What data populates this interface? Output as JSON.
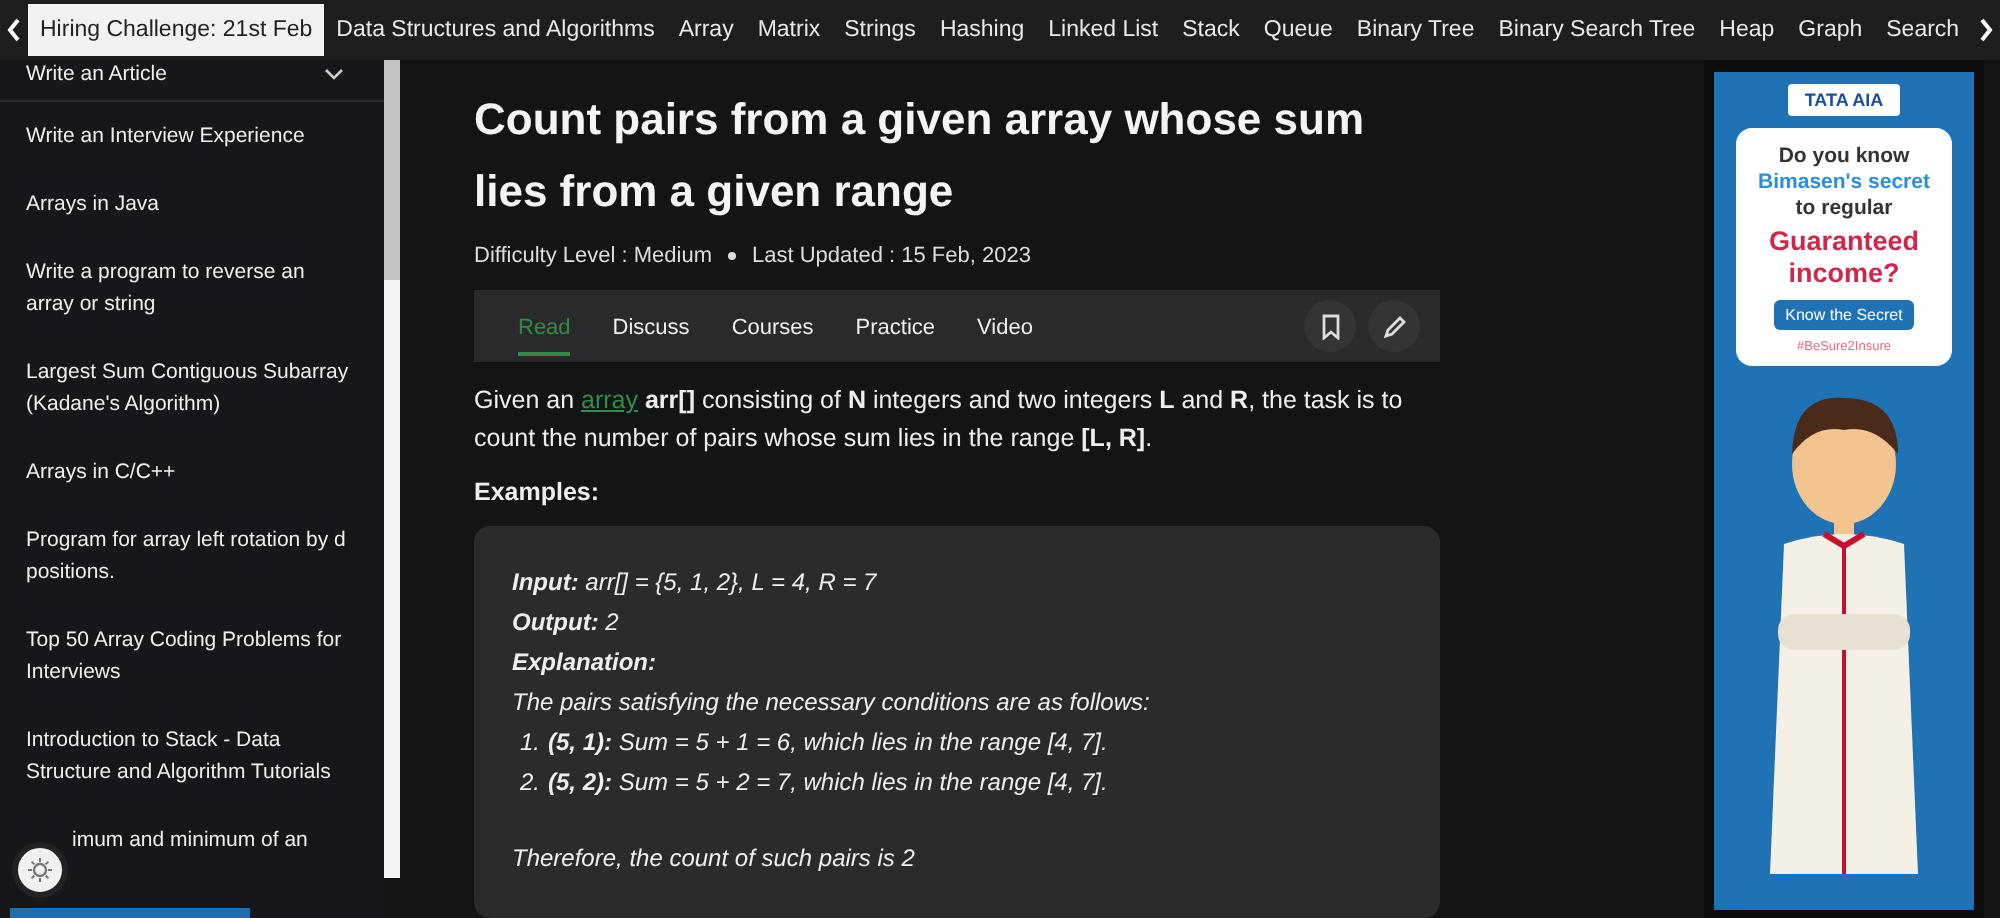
{
  "nav": {
    "items": [
      {
        "label": "Hiring Challenge: 21st Feb",
        "selected": true
      },
      {
        "label": "Data Structures and Algorithms",
        "selected": false
      },
      {
        "label": "Array",
        "selected": false
      },
      {
        "label": "Matrix",
        "selected": false
      },
      {
        "label": "Strings",
        "selected": false
      },
      {
        "label": "Hashing",
        "selected": false
      },
      {
        "label": "Linked List",
        "selected": false
      },
      {
        "label": "Stack",
        "selected": false
      },
      {
        "label": "Queue",
        "selected": false
      },
      {
        "label": "Binary Tree",
        "selected": false
      },
      {
        "label": "Binary Search Tree",
        "selected": false
      },
      {
        "label": "Heap",
        "selected": false
      },
      {
        "label": "Graph",
        "selected": false
      },
      {
        "label": "Search",
        "selected": false
      }
    ]
  },
  "sidebar": {
    "header": "Write an Article",
    "items": [
      "Write an Interview Experience",
      "Arrays in Java",
      "Write a program to reverse an array or string",
      "Largest Sum Contiguous Subarray (Kadane's Algorithm)",
      "Arrays in C/C++",
      "Program for array left rotation by d positions.",
      "Top 50 Array Coding Problems for Interviews",
      "Introduction to Stack - Data Structure and Algorithm Tutorials",
      "imum and minimum of an"
    ]
  },
  "article": {
    "title": "Count pairs from a given array whose sum lies from a given range",
    "difficulty": "Difficulty Level : Medium",
    "updated": "Last Updated : 15 Feb, 2023",
    "tabs": [
      {
        "label": "Read",
        "selected": true
      },
      {
        "label": "Discuss",
        "selected": false
      },
      {
        "label": "Courses",
        "selected": false
      },
      {
        "label": "Practice",
        "selected": false
      },
      {
        "label": "Video",
        "selected": false
      }
    ],
    "intro": {
      "before": "Given an",
      "link": "array",
      "after": "**arr[]** consisting of **N** integers and two integers **L** and **R**, the task is to count the number of pairs whose sum lies in the range **[L, R]**."
    },
    "examples_heading": "Examples:",
    "example": {
      "input": "**Input:** arr[] = {5, 1, 2}, L = 4, R = 7",
      "output": "**Output:** 2",
      "explanation": "Explanation:",
      "text": "The pairs satisfying the necessary conditions are as follows:",
      "list": [
        {
          "number": "1.",
          "text": "**(5, 1):** Sum = 5 + 1 = 6, which lies in the range [4, 7]."
        },
        {
          "number": "2.",
          "text": "**(5, 2):** Sum = 5 + 2 = 7, which lies in the range [4, 7]."
        }
      ],
      "conclusion": "Therefore, the count of such pairs is 2"
    }
  },
  "ad": {
    "brand": "TATA AIA",
    "lines": [
      "Do you know",
      "Bimasen's secret",
      "to regular"
    ],
    "highlight": "Guaranteed income?",
    "button": "Know the Secret",
    "hashtag": "#BeSure2Insure"
  }
}
